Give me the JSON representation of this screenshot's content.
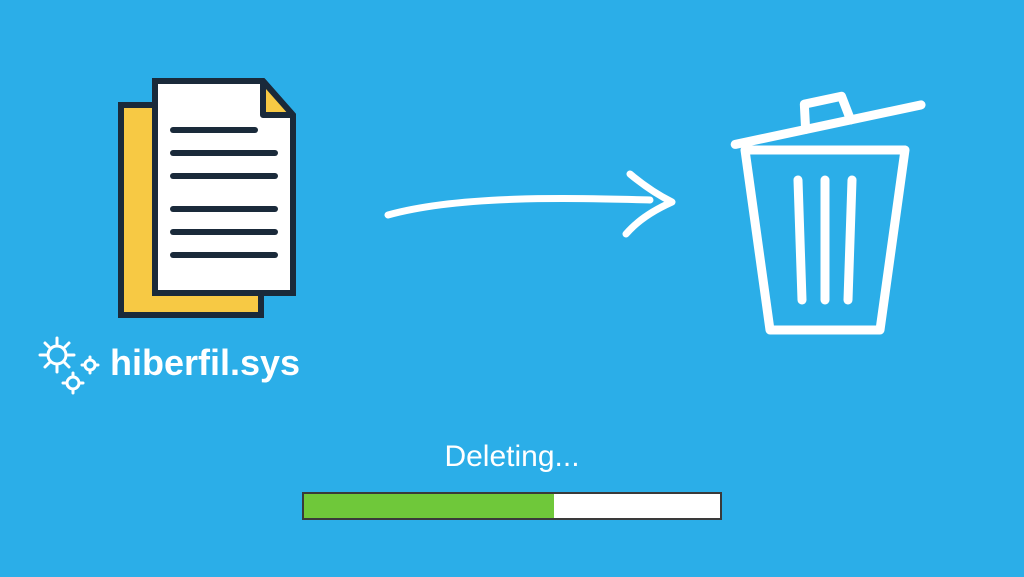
{
  "file": {
    "label": "hiberfil.sys"
  },
  "status": {
    "text": "Deleting..."
  },
  "progress": {
    "percent": 60
  },
  "icons": {
    "file": "document-stack-icon",
    "gears": "gears-icon",
    "arrow": "arrow-right-icon",
    "trash": "trash-icon"
  },
  "colors": {
    "background": "#2baee8",
    "progress_fill": "#6fc83a",
    "doc_back": "#f7c944",
    "stroke": "#1a2a3a"
  }
}
